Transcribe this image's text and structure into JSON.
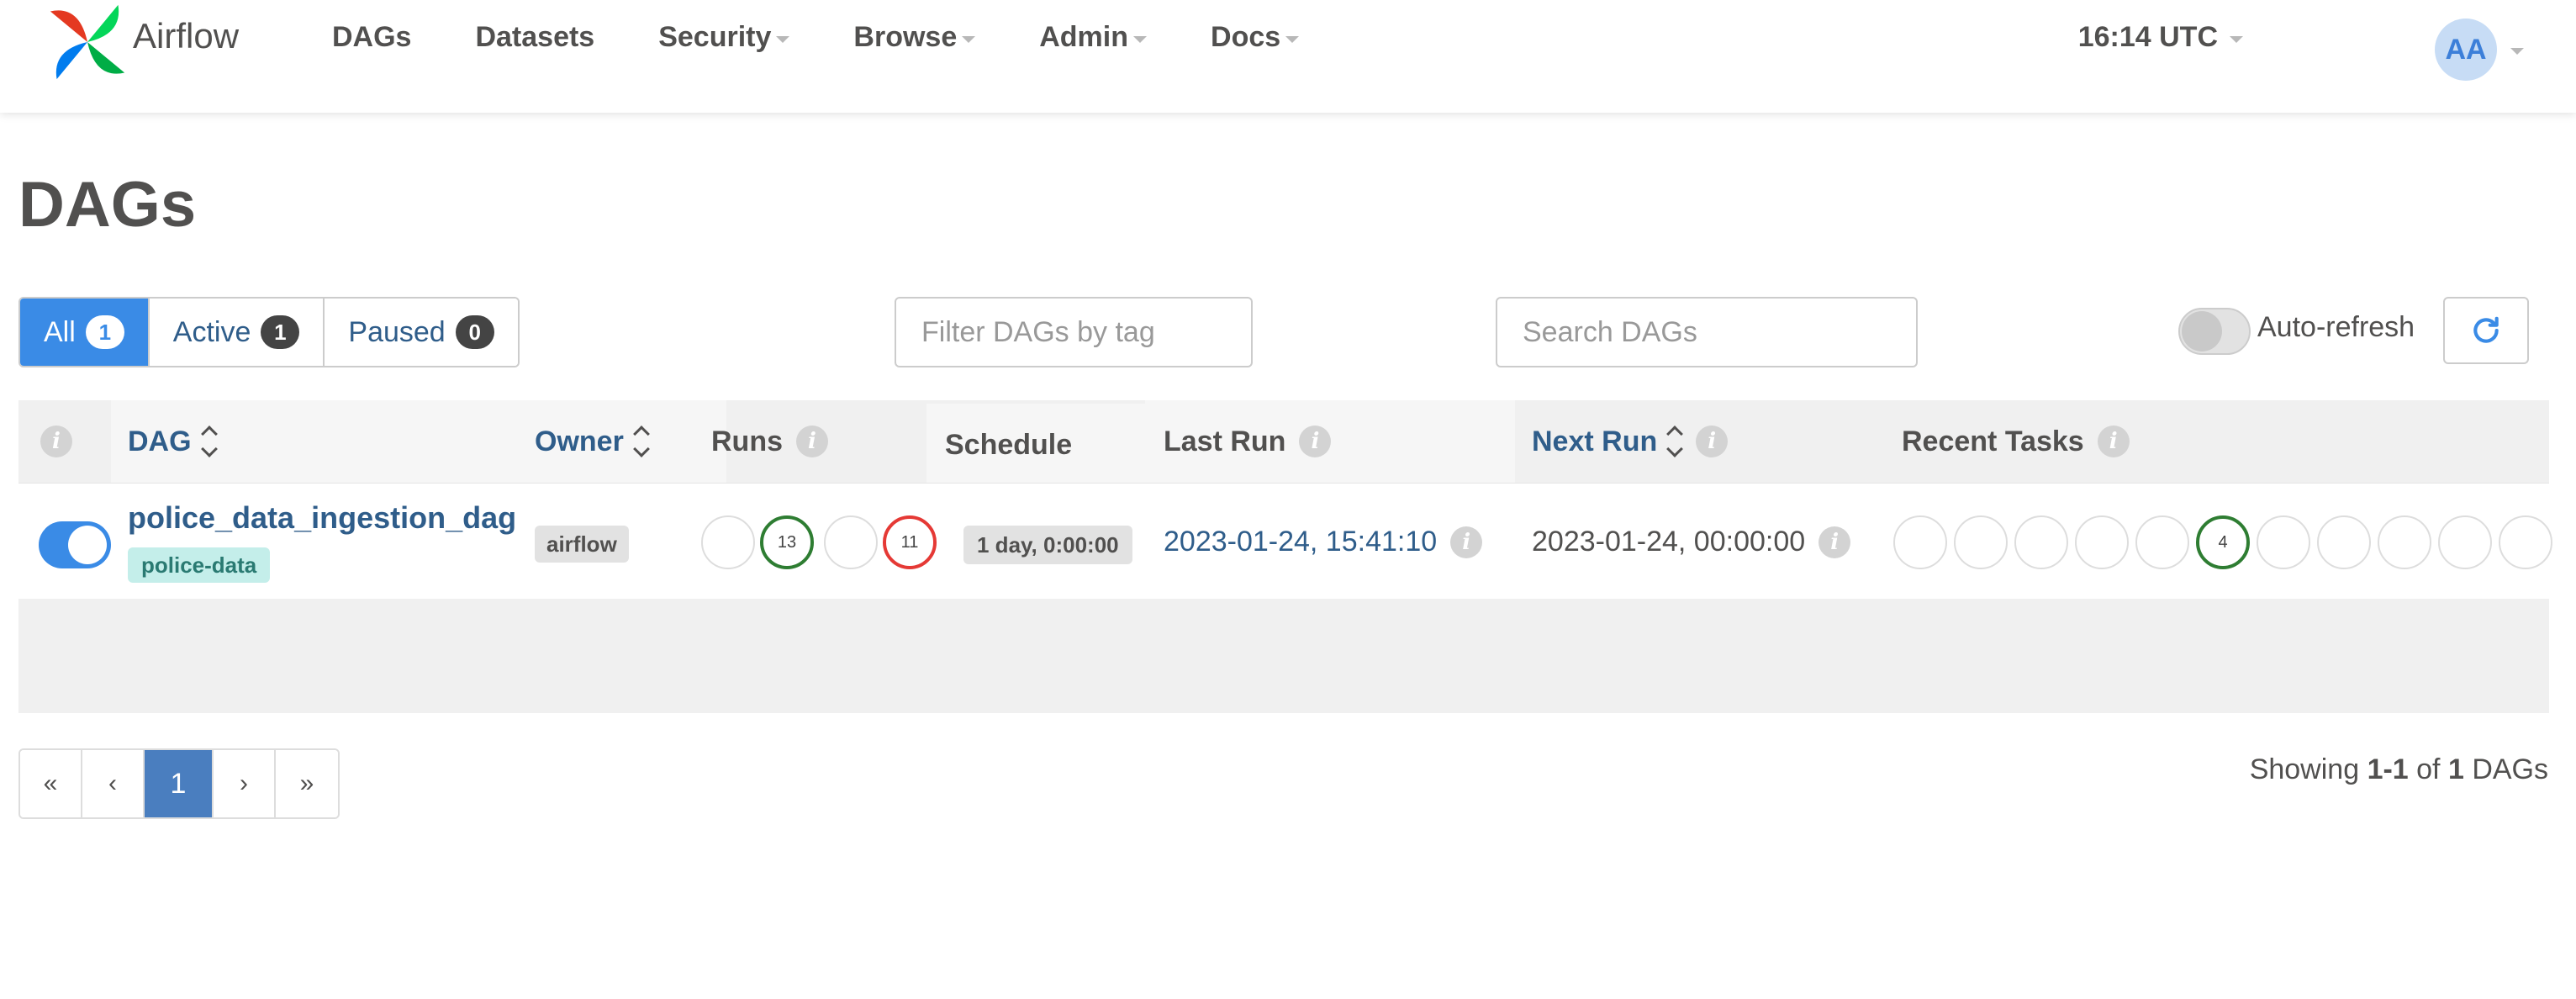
{
  "navbar": {
    "brand": "Airflow",
    "items": [
      {
        "label": "DAGs",
        "dropdown": false
      },
      {
        "label": "Datasets",
        "dropdown": false
      },
      {
        "label": "Security",
        "dropdown": true
      },
      {
        "label": "Browse",
        "dropdown": true
      },
      {
        "label": "Admin",
        "dropdown": true
      },
      {
        "label": "Docs",
        "dropdown": true
      }
    ],
    "clock": "16:14 UTC",
    "avatar": "AA"
  },
  "page_title": "DAGs",
  "status_filter": {
    "all": {
      "label": "All",
      "count": "1"
    },
    "active": {
      "label": "Active",
      "count": "1"
    },
    "paused": {
      "label": "Paused",
      "count": "0"
    }
  },
  "tag_filter": {
    "placeholder": "Filter DAGs by tag"
  },
  "search": {
    "placeholder": "Search DAGs"
  },
  "auto_refresh": {
    "label": "Auto-refresh",
    "enabled": false
  },
  "table": {
    "headers": {
      "dag": "DAG",
      "owner": "Owner",
      "runs": "Runs",
      "schedule": "Schedule",
      "last_run": "Last Run",
      "next_run": "Next Run",
      "recent_tasks": "Recent Tasks"
    },
    "rows": [
      {
        "active": true,
        "dag_id": "police_data_ingestion_dag",
        "tag": "police-data",
        "owner": "airflow",
        "runs": [
          {
            "state": "queued",
            "count": ""
          },
          {
            "state": "success",
            "count": "13"
          },
          {
            "state": "running",
            "count": ""
          },
          {
            "state": "failed",
            "count": "11"
          }
        ],
        "schedule": "1 day, 0:00:00",
        "last_run": "2023-01-24, 15:41:10",
        "next_run": "2023-01-24, 00:00:00",
        "recent_tasks": [
          {
            "state": "none",
            "count": ""
          },
          {
            "state": "removed",
            "count": ""
          },
          {
            "state": "scheduled",
            "count": ""
          },
          {
            "state": "queued",
            "count": ""
          },
          {
            "state": "running",
            "count": ""
          },
          {
            "state": "success",
            "count": "4"
          },
          {
            "state": "restarting",
            "count": ""
          },
          {
            "state": "failed",
            "count": ""
          },
          {
            "state": "up_for_retry",
            "count": ""
          },
          {
            "state": "up_for_reschedule",
            "count": ""
          },
          {
            "state": "upstream_failed",
            "count": ""
          }
        ]
      }
    ]
  },
  "pagination": {
    "first": "«",
    "prev": "‹",
    "current": "1",
    "next": "›",
    "last": "»"
  },
  "showing": {
    "prefix": "Showing ",
    "range": "1-1",
    "of": " of ",
    "total": "1",
    "suffix": " DAGs"
  },
  "colors": {
    "primary": "#3a8be6",
    "link": "#2f5d8a",
    "success": "#2e7d32",
    "failed": "#e53935",
    "tag_bg": "#c4eeea"
  }
}
